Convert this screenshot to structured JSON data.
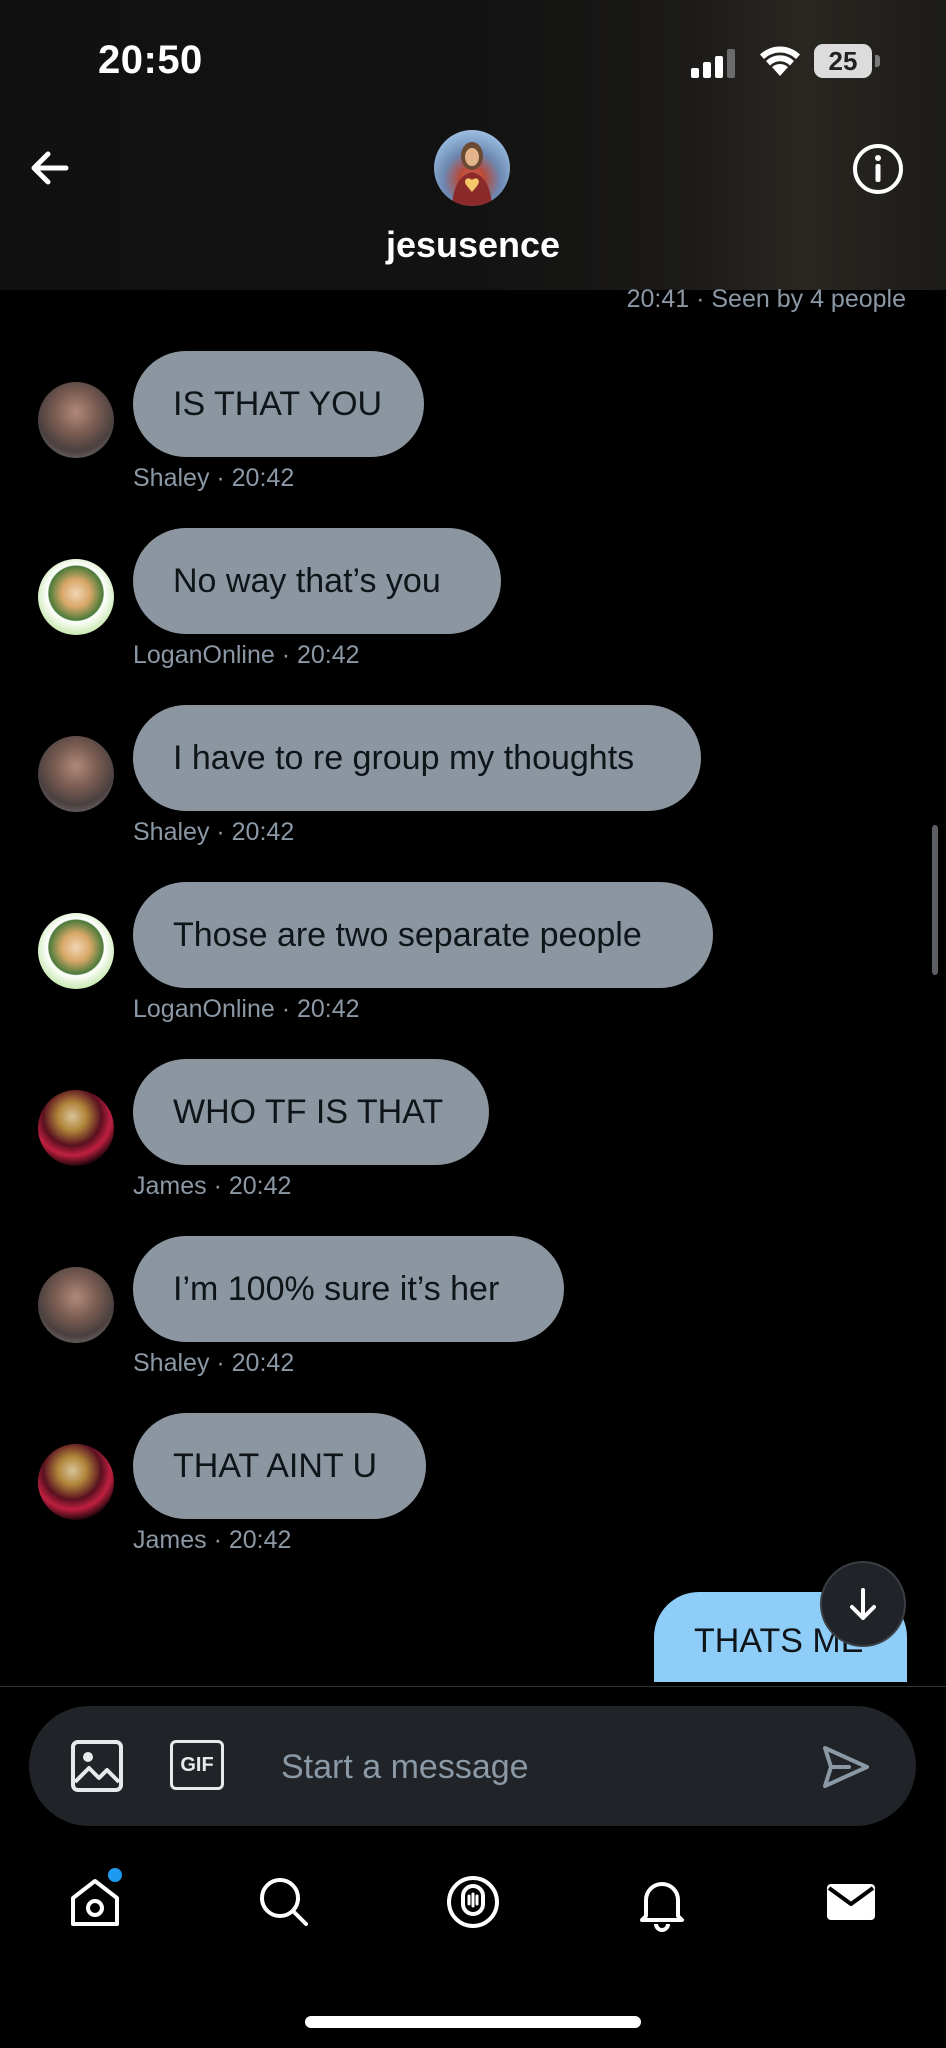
{
  "status_bar": {
    "time": "20:50",
    "battery": "25"
  },
  "header": {
    "title": "jesusence"
  },
  "seen_status": "20:41 · Seen by 4 people",
  "messages": [
    {
      "text": "IS THAT YOU",
      "sender": "Shaley",
      "time": "20:42",
      "meta": "Shaley · 20:42"
    },
    {
      "text": "No way that’s you",
      "sender": "LoganOnline",
      "time": "20:42",
      "meta": "LoganOnline · 20:42"
    },
    {
      "text": "I have to re group my thoughts",
      "sender": "Shaley",
      "time": "20:42",
      "meta": "Shaley · 20:42"
    },
    {
      "text": "Those are two separate people",
      "sender": "LoganOnline",
      "time": "20:42",
      "meta": "LoganOnline · 20:42"
    },
    {
      "text": "WHO TF IS THAT",
      "sender": "James",
      "time": "20:42",
      "meta": "James · 20:42"
    },
    {
      "text": "I’m 100% sure it’s her",
      "sender": "Shaley",
      "time": "20:42",
      "meta": "Shaley · 20:42"
    },
    {
      "text": "THAT AINT U",
      "sender": "James",
      "time": "20:42",
      "meta": "James · 20:42"
    }
  ],
  "outgoing_message": {
    "text": "THATS ME"
  },
  "composer": {
    "placeholder": "Start a message",
    "gif_label": "GIF"
  },
  "tab_bar": {
    "items": [
      "home-icon",
      "search-icon",
      "spaces-icon",
      "notifications-icon",
      "messages-icon"
    ],
    "home_has_new": true
  },
  "colors": {
    "incoming_bubble": "#8b96a0",
    "outgoing_bubble": "#8ecdf8",
    "accent": "#1d9bf0",
    "secondary_text": "#8b98a5"
  }
}
